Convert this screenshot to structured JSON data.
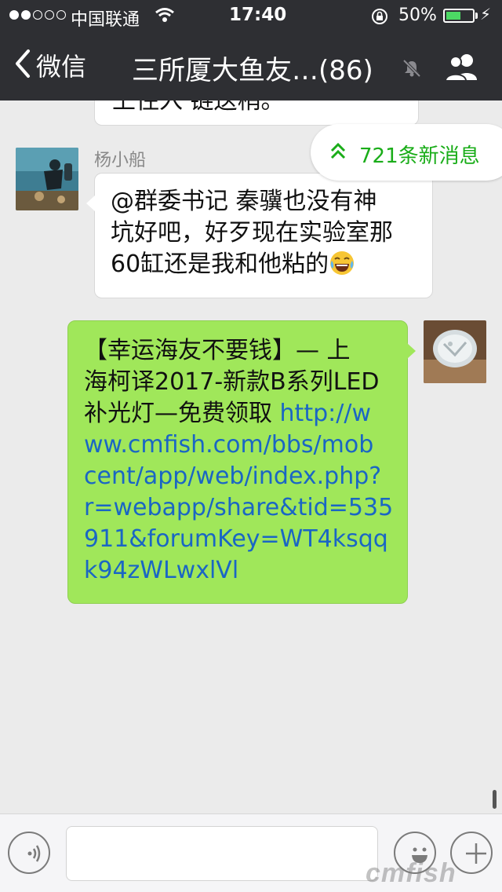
{
  "status_bar": {
    "carrier": "中国联通",
    "time": "17:40",
    "battery_percent": "50%",
    "signal_bars_filled": 2,
    "signal_bars_total": 5
  },
  "nav": {
    "back_label": "微信",
    "title": "三所厦大鱼友…(86)",
    "icons": [
      "back-chevron-icon",
      "mute-bell-icon",
      "group-members-icon"
    ]
  },
  "chat": {
    "previous_message_partial": "上住入 链送稍。",
    "messages": [
      {
        "side": "left",
        "sender": "杨小船",
        "lines": [
          "@群委书记 秦骥也没有神",
          "坑好吧，好歹现在实验室那",
          "60缸还是我和他粘的"
        ]
      },
      {
        "side": "right",
        "text_lines": [
          "【幸运海友不要钱】— 上",
          "海柯译2017-新款B系列LED",
          "补光灯—免费领取 "
        ],
        "link_lines": [
          "http://w",
          "ww.cmfish.com/bbs/mob",
          "cent/app/web/index.php?",
          "r=webapp/share&tid=535",
          "911&forumKey=WT4ksqq",
          "k94zWLwxlVl"
        ]
      }
    ],
    "new_messages_badge": "721条新消息"
  },
  "input_bar": {
    "placeholder": "",
    "icons": [
      "voice-icon",
      "emoji-icon",
      "plus-icon"
    ]
  },
  "watermark": "cmfish",
  "colors": {
    "header_bg": "#2e2f33",
    "chat_bg": "#ebebeb",
    "sent_bubble": "#a0e75a",
    "link": "#1a66c4",
    "badge_text": "#1aad19"
  }
}
